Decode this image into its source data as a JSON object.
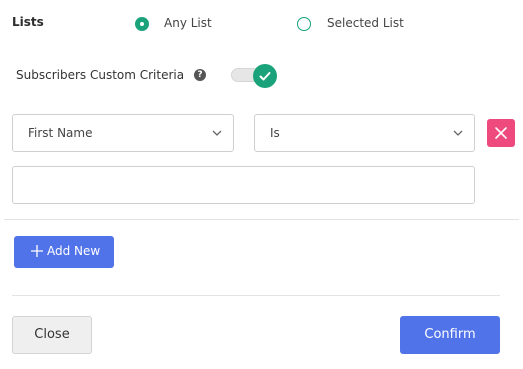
{
  "lists": {
    "label": "Lists",
    "options": [
      {
        "label": "Any List",
        "selected": true
      },
      {
        "label": "Selected List",
        "selected": false
      }
    ]
  },
  "criteria": {
    "label": "Subscribers Custom Criteria",
    "help_icon": "question-circle-icon",
    "toggle_on": true
  },
  "filter": {
    "field": "First Name",
    "operator": "Is",
    "value": "",
    "delete_icon": "close-icon"
  },
  "actions": {
    "add_new": "Add New",
    "close": "Close",
    "confirm": "Confirm"
  },
  "colors": {
    "accent_green": "#1aa37a",
    "primary_blue": "#5173e9",
    "danger_pink": "#ee4a7d"
  }
}
